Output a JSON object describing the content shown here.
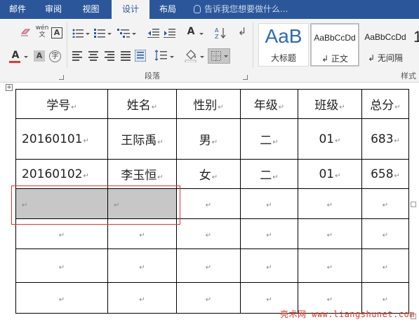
{
  "ribbon": {
    "tabs": [
      "邮件",
      "审阅",
      "视图",
      "设计",
      "布局"
    ],
    "tell_me": "告诉我您想要做什么...",
    "font_group": {
      "clear_format_icon": "clear-formatting-icon",
      "phonetic_label": "wén",
      "char_border_label": "A",
      "font_color_label": "A",
      "font_color": "#e23b2e",
      "char_shading_label": "A",
      "enclose_char_label": "字"
    },
    "paragraph_group": {
      "label": "段落"
    },
    "styles_group": {
      "label": "样式",
      "items": [
        {
          "sample": "AaB",
          "name": "大标题",
          "accent": "#2e6ab3"
        },
        {
          "sample": "AaBbCcDd",
          "name": "↲ 正文",
          "selected": true
        },
        {
          "sample": "AaBbCcDd",
          "name": "↲ 无间隔"
        },
        {
          "sample": "1",
          "name": ""
        }
      ]
    }
  },
  "table": {
    "end_mark": "↵",
    "move_handle": "+",
    "header": [
      "学号",
      "姓名",
      "性别",
      "年级",
      "班级",
      "总分"
    ],
    "rows": [
      [
        "20160101",
        "王际禹",
        "男",
        "二",
        "01",
        "683"
      ],
      [
        "20160102",
        "李玉恒",
        "女",
        "二",
        "01",
        "658"
      ],
      [
        "",
        "",
        "",
        "",
        "",
        ""
      ],
      [
        "",
        "",
        "",
        "",
        "",
        ""
      ],
      [
        "",
        "",
        "",
        "",
        "",
        ""
      ],
      [
        "",
        "",
        "",
        "",
        "",
        ""
      ]
    ],
    "shaded_cells": [
      [
        2,
        0
      ],
      [
        2,
        1
      ]
    ],
    "shade_color": "#c7c7c7",
    "highlight_color": "#e0342c"
  },
  "watermark": "亮术网 www.liangshunet.com"
}
